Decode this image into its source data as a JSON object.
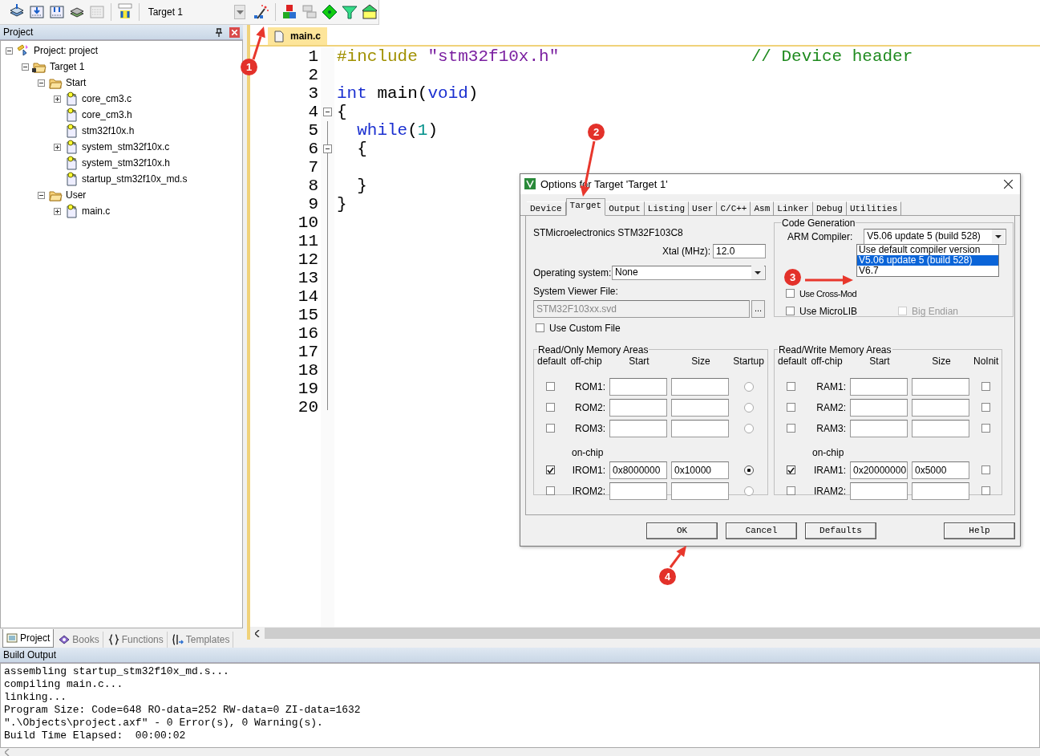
{
  "toolbar": {
    "target": "Target 1"
  },
  "project_panel": {
    "title": "Project",
    "tree": [
      {
        "label": "Project: project",
        "kind": "project",
        "expanded": true,
        "children": [
          {
            "label": "Target 1",
            "kind": "target",
            "expanded": true,
            "children": [
              {
                "label": "Start",
                "kind": "folder",
                "expanded": true,
                "children": [
                  {
                    "label": "core_cm3.c",
                    "kind": "file",
                    "expanded": false
                  },
                  {
                    "label": "core_cm3.h",
                    "kind": "file"
                  },
                  {
                    "label": "stm32f10x.h",
                    "kind": "file"
                  },
                  {
                    "label": "system_stm32f10x.c",
                    "kind": "file",
                    "expanded": false
                  },
                  {
                    "label": "system_stm32f10x.h",
                    "kind": "file"
                  },
                  {
                    "label": "startup_stm32f10x_md.s",
                    "kind": "file"
                  }
                ]
              },
              {
                "label": "User",
                "kind": "folder",
                "expanded": true,
                "children": [
                  {
                    "label": "main.c",
                    "kind": "file",
                    "expanded": false
                  }
                ]
              }
            ]
          }
        ]
      }
    ],
    "tabs": [
      {
        "label": "Project",
        "kind": "project",
        "selected": true
      },
      {
        "label": "Books",
        "kind": "books",
        "selected": false
      },
      {
        "label": "Functions",
        "kind": "functions",
        "selected": false
      },
      {
        "label": "Templates",
        "kind": "templates",
        "selected": false
      }
    ]
  },
  "editor": {
    "tabs": [
      {
        "label": "main.c",
        "selected": true
      }
    ],
    "lines": [
      {
        "number": "1",
        "tokens": [
          {
            "kind": "preprocessor",
            "text": "#include"
          },
          {
            "kind": "string",
            "text": "\"stm32f10x.h\"",
            "spaced": true
          },
          {
            "kind": "comment",
            "text": "// Device header"
          }
        ]
      },
      {
        "number": "2"
      },
      {
        "number": "3",
        "tokens": [
          {
            "kind": "keyword",
            "text": "int"
          },
          {
            "kind": "plain",
            "text": "main(",
            "spaced": true
          },
          {
            "kind": "keyword",
            "text": "void"
          },
          {
            "kind": "plain",
            "text": ")"
          }
        ]
      },
      {
        "number": "4",
        "foldable": true,
        "tokens": [
          {
            "kind": "plain",
            "text": "{"
          }
        ]
      },
      {
        "number": "5",
        "indented": true,
        "tokens": [
          {
            "kind": "keyword",
            "text": "while"
          },
          {
            "kind": "plain",
            "text": "("
          },
          {
            "kind": "number",
            "text": "1"
          },
          {
            "kind": "plain",
            "text": ")"
          }
        ]
      },
      {
        "number": "6",
        "foldable": true,
        "indented": true,
        "tokens": [
          {
            "kind": "plain",
            "text": "{"
          }
        ]
      },
      {
        "number": "7"
      },
      {
        "number": "8",
        "indented": true,
        "tokens": [
          {
            "kind": "plain",
            "text": "}"
          }
        ]
      },
      {
        "number": "9",
        "tokens": [
          {
            "kind": "plain",
            "text": "}"
          }
        ]
      },
      {
        "number": "10"
      },
      {
        "number": "11"
      },
      {
        "number": "12"
      },
      {
        "number": "13"
      },
      {
        "number": "14"
      },
      {
        "number": "15"
      },
      {
        "number": "16"
      },
      {
        "number": "17"
      },
      {
        "number": "18"
      },
      {
        "number": "19"
      },
      {
        "number": "20"
      }
    ]
  },
  "build_output": {
    "title": "Build Output",
    "lines": [
      "assembling startup_stm32f10x_md.s...",
      "compiling main.c...",
      "linking...",
      "Program Size: Code=648 RO-data=252 RW-data=0 ZI-data=1632",
      "\".\\Objects\\project.axf\" - 0 Error(s), 0 Warning(s).",
      "Build Time Elapsed:  00:00:02"
    ]
  },
  "dialog": {
    "title": "Options for Target 'Target 1'",
    "tabs": [
      {
        "label": "Device",
        "selected": false
      },
      {
        "label": "Target",
        "selected": true
      },
      {
        "label": "Output",
        "selected": false
      },
      {
        "label": "Listing",
        "selected": false
      },
      {
        "label": "User",
        "selected": false
      },
      {
        "label": "C/C++",
        "selected": false
      },
      {
        "label": "Asm",
        "selected": false
      },
      {
        "label": "Linker",
        "selected": false
      },
      {
        "label": "Debug",
        "selected": false
      },
      {
        "label": "Utilities",
        "selected": false
      }
    ],
    "device": "STMicroelectronics STM32F103C8",
    "xtal": {
      "label": "Xtal (MHz):",
      "value": "12.0"
    },
    "os": {
      "label": "Operating system:",
      "value": "None"
    },
    "svd": {
      "label": "System Viewer File:",
      "value": "STM32F103xx.svd",
      "disabled": true,
      "browse": "..."
    },
    "custom_file": {
      "label": "Use Custom File",
      "checked": false
    },
    "code_generation": {
      "title": "Code Generation",
      "compiler_label": "ARM Compiler:",
      "compiler": "V5.06 update 5 (build 528)",
      "options": [
        {
          "label": "Use default compiler version",
          "selected": false
        },
        {
          "label": "V5.06 update 5 (build 528)",
          "selected": true
        },
        {
          "label": "V6.7",
          "selected": false
        }
      ],
      "checks": [
        {
          "label": "Use Cross-Mod",
          "checked": false,
          "disabled": false
        },
        {
          "label": "Use MicroLIB",
          "checked": false,
          "disabled": false
        },
        {
          "label": "Big Endian",
          "checked": false,
          "disabled": true
        }
      ]
    },
    "memory": [
      {
        "title": "Read/Only Memory Areas",
        "kind": "rom",
        "columns": [
          "default",
          "off-chip",
          "Start",
          "Size",
          "Startup"
        ],
        "rows": [
          {
            "kind": "row",
            "label": "ROM1:",
            "default": false,
            "flag": false
          },
          {
            "kind": "row",
            "label": "ROM2:",
            "default": false,
            "flag": false
          },
          {
            "kind": "row",
            "label": "ROM3:",
            "default": false,
            "flag": false
          },
          {
            "kind": "heading",
            "label": "on-chip"
          },
          {
            "kind": "row",
            "label": "IROM1:",
            "default": true,
            "start": "0x8000000",
            "size": "0x10000",
            "flag": true
          },
          {
            "kind": "row",
            "label": "IROM2:",
            "default": false,
            "flag": false
          }
        ]
      },
      {
        "title": "Read/Write Memory Areas",
        "kind": "ram",
        "columns": [
          "default",
          "off-chip",
          "Start",
          "Size",
          "NoInit"
        ],
        "rows": [
          {
            "kind": "row",
            "label": "RAM1:",
            "default": false,
            "flag": false
          },
          {
            "kind": "row",
            "label": "RAM2:",
            "default": false,
            "flag": false
          },
          {
            "kind": "row",
            "label": "RAM3:",
            "default": false,
            "flag": false
          },
          {
            "kind": "heading",
            "label": "on-chip"
          },
          {
            "kind": "row",
            "label": "IRAM1:",
            "default": true,
            "start": "0x20000000",
            "size": "0x5000",
            "flag": false
          },
          {
            "kind": "row",
            "label": "IRAM2:",
            "default": false,
            "flag": false
          }
        ]
      }
    ],
    "buttons": [
      "OK",
      "Cancel",
      "Defaults",
      "Help"
    ]
  },
  "annotations": [
    {
      "number": "1"
    },
    {
      "number": "2"
    },
    {
      "number": "3"
    },
    {
      "number": "4"
    }
  ]
}
